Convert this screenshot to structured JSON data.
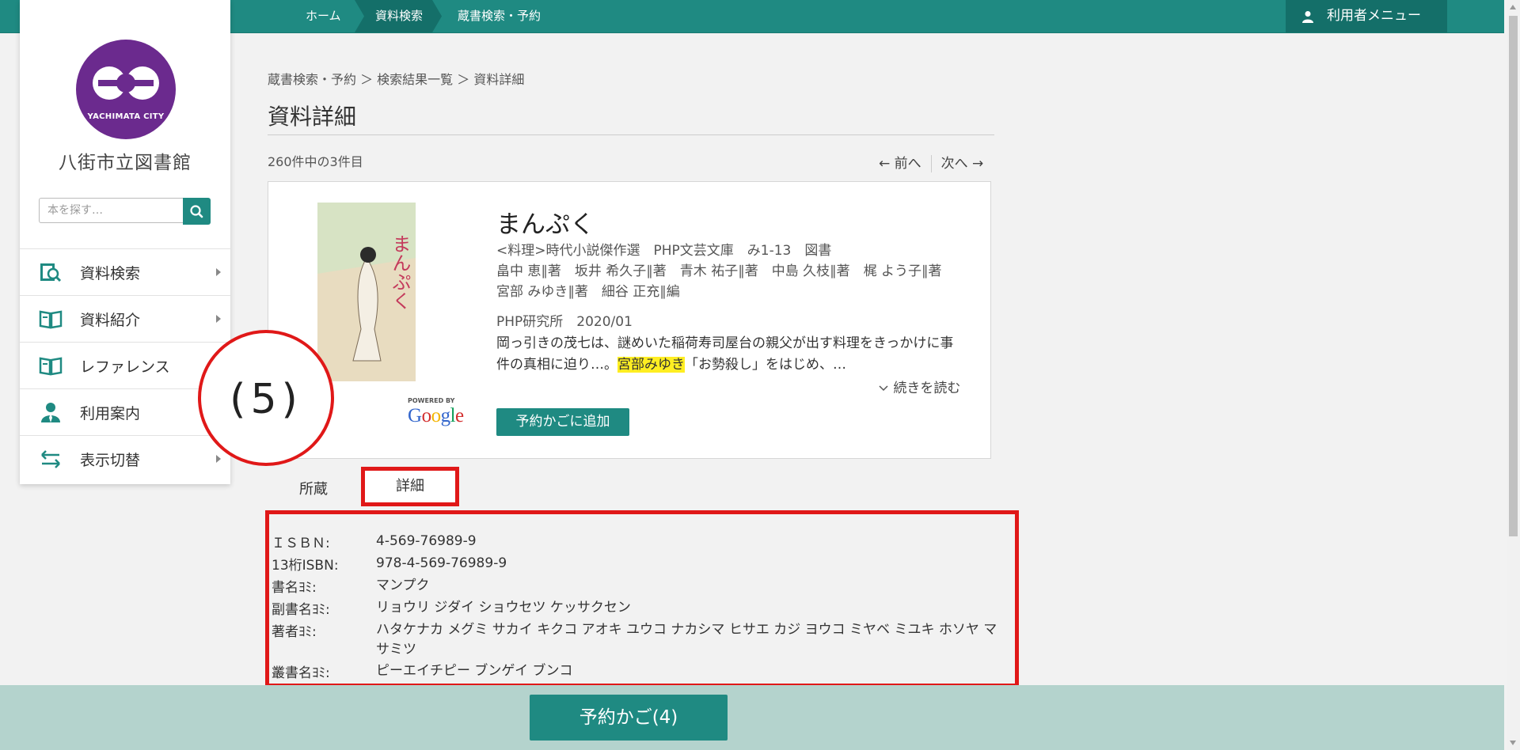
{
  "topbar": {
    "crumbs": [
      "ホーム",
      "資料検索",
      "蔵書検索・予約"
    ],
    "user_menu": "利用者メニュー"
  },
  "sidebar": {
    "logo_text": "YACHIMATA CITY",
    "library_name": "八街市立図書館",
    "search_placeholder": "本を探す…",
    "items": [
      {
        "label": "資料検索",
        "icon": "search-book-icon"
      },
      {
        "label": "資料紹介",
        "icon": "open-book-icon"
      },
      {
        "label": "レファレンス",
        "icon": "open-book-icon"
      },
      {
        "label": "利用案内",
        "icon": "person-icon"
      },
      {
        "label": "表示切替",
        "icon": "switch-arrows-icon"
      }
    ]
  },
  "main": {
    "path": "蔵書検索・予約 ＞ 検索結果一覧 ＞ 資料詳細",
    "title": "資料詳細",
    "count": "260件中の3件目",
    "prev": "← 前へ",
    "next": "次へ →"
  },
  "book": {
    "title": "まんぷく",
    "series": "<料理>時代小説傑作選　PHP文芸文庫　み1-13　図書",
    "authors": "畠中 恵∥著　坂井 希久子∥著　青木 祐子∥著　中島 久枝∥著　梶 よう子∥著　宮部 みゆき∥著　細谷 正充∥編",
    "publisher": "PHP研究所　2020/01",
    "desc_before": "岡っ引きの茂七は、謎めいた稲荷寿司屋台の親父が出す料理をきっかけに事件の真相に迫り…。",
    "desc_highlight": "宮部みゆき",
    "desc_after": "「お勢殺し」をはじめ、…",
    "more": "続きを読む",
    "add_button": "予約かごに追加",
    "powered_by": "POWERED BY",
    "google": "Google",
    "cover_text": "まんぷく"
  },
  "annotation": {
    "label": "(5)"
  },
  "tabs": {
    "holdings": "所蔵",
    "details": "詳細"
  },
  "details": [
    {
      "label": "ＩＳＢＮ:",
      "value": "4-569-76989-9"
    },
    {
      "label": "13桁ISBN:",
      "value": "978-4-569-76989-9"
    },
    {
      "label": "書名ﾖﾐ:",
      "value": "マンプク"
    },
    {
      "label": "副書名ﾖﾐ:",
      "value": "リョウリ ジダイ ショウセツ ケッサクセン"
    },
    {
      "label": "著者ﾖﾐ:",
      "value": "ハタケナカ メグミ サカイ キクコ アオキ ユウコ ナカシマ ヒサエ カジ ヨウコ ミヤベ ミユキ ホソヤ マサミツ"
    },
    {
      "label": "叢書名ﾖﾐ:",
      "value": "ピーエイチピー ブンゲイ ブンコ"
    }
  ],
  "footer": {
    "basket": "予約かご(4)"
  },
  "colors": {
    "primary": "#1f8a82",
    "primary_dark": "#146f69",
    "annotation_red": "#e01818",
    "logo_purple": "#6b2a8e",
    "highlight": "#ffee22"
  }
}
